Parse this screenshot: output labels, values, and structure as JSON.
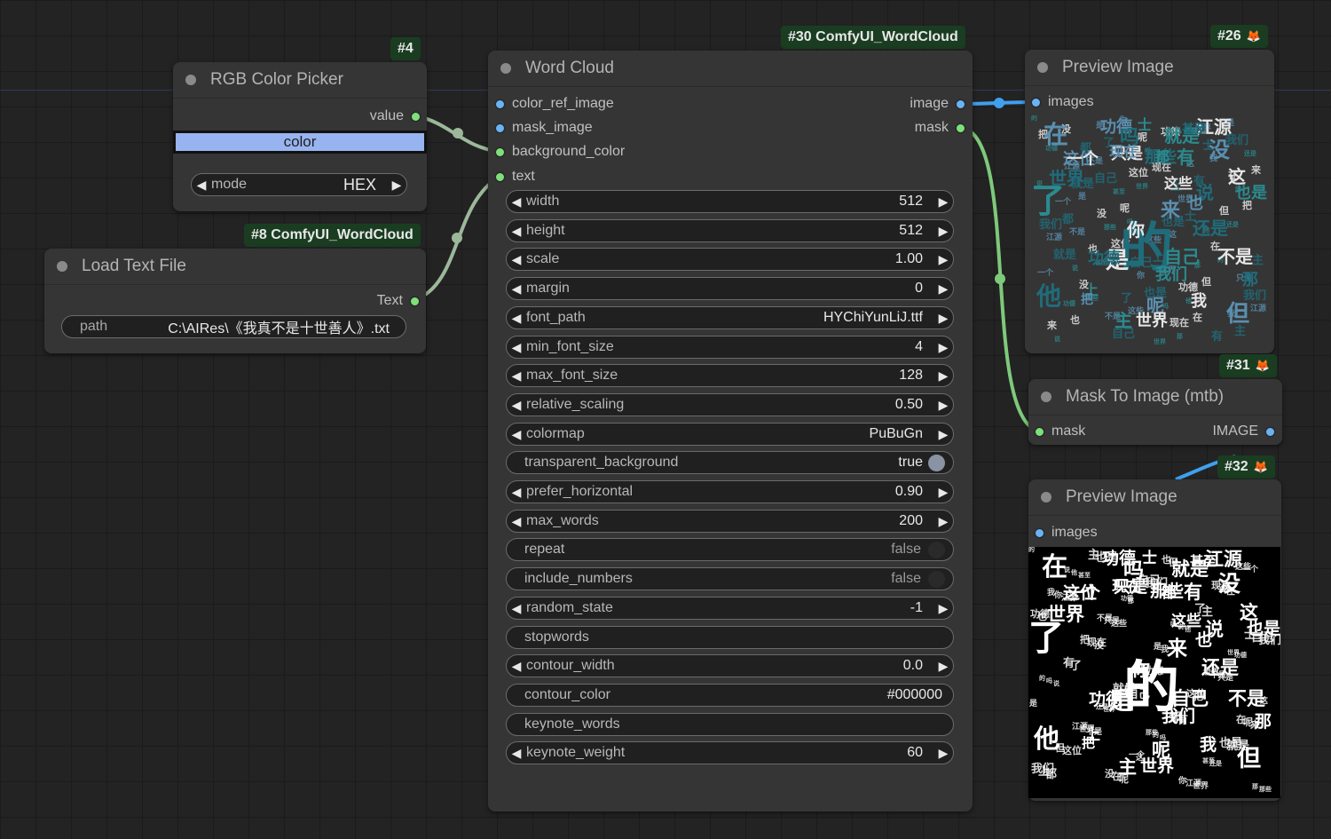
{
  "nodes": {
    "rgb_picker": {
      "badge": "#4",
      "title": "RGB Color Picker",
      "output_label": "value",
      "color_label": "color",
      "color_value": "#98b4f0",
      "mode_label": "mode",
      "mode_value": "HEX"
    },
    "load_text": {
      "badge": "#8 ComfyUI_WordCloud",
      "title": "Load Text File",
      "output_label": "Text",
      "path_label": "path",
      "path_value": "C:\\AIRes\\《我真不是十世善人》.txt"
    },
    "word_cloud": {
      "badge": "#30 ComfyUI_WordCloud",
      "title": "Word Cloud",
      "inputs": [
        "color_ref_image",
        "mask_image",
        "background_color",
        "text"
      ],
      "outputs": [
        "image",
        "mask"
      ],
      "widgets": [
        {
          "label": "width",
          "value": "512",
          "kind": "number"
        },
        {
          "label": "height",
          "value": "512",
          "kind": "number"
        },
        {
          "label": "scale",
          "value": "1.00",
          "kind": "number"
        },
        {
          "label": "margin",
          "value": "0",
          "kind": "number"
        },
        {
          "label": "font_path",
          "value": "HYChiYunLiJ.ttf",
          "kind": "number"
        },
        {
          "label": "min_font_size",
          "value": "4",
          "kind": "number"
        },
        {
          "label": "max_font_size",
          "value": "128",
          "kind": "number"
        },
        {
          "label": "relative_scaling",
          "value": "0.50",
          "kind": "number"
        },
        {
          "label": "colormap",
          "value": "PuBuGn",
          "kind": "number"
        },
        {
          "label": "transparent_background",
          "value": "true",
          "kind": "toggle_on"
        },
        {
          "label": "prefer_horizontal",
          "value": "0.90",
          "kind": "number"
        },
        {
          "label": "max_words",
          "value": "200",
          "kind": "number"
        },
        {
          "label": "repeat",
          "value": "false",
          "kind": "toggle_off"
        },
        {
          "label": "include_numbers",
          "value": "false",
          "kind": "toggle_off"
        },
        {
          "label": "random_state",
          "value": "-1",
          "kind": "number"
        },
        {
          "label": "stopwords",
          "value": "",
          "kind": "text"
        },
        {
          "label": "contour_width",
          "value": "0.0",
          "kind": "number"
        },
        {
          "label": "contour_color",
          "value": "#000000",
          "kind": "text"
        },
        {
          "label": "keynote_words",
          "value": "",
          "kind": "text"
        },
        {
          "label": "keynote_weight",
          "value": "60",
          "kind": "number"
        }
      ]
    },
    "preview_1": {
      "badge": "#26",
      "title": "Preview Image",
      "input_label": "images"
    },
    "mask_to_image": {
      "badge": "#31",
      "title": "Mask To Image (mtb)",
      "input_label": "mask",
      "output_label": "IMAGE"
    },
    "preview_2": {
      "badge": "#32",
      "title": "Preview Image",
      "input_label": "images"
    }
  },
  "colors": {
    "link_green": "#7ec97b",
    "link_blue": "#3fa0ef",
    "badge_bg": "#1a3d21",
    "cloud_teal": [
      "#1f6c7a",
      "#2b8a8f",
      "#5a8fb0",
      "#e6e6e6"
    ],
    "cloud_white": "#ffffff"
  },
  "icons": {
    "badge_icon": "fox-icon"
  },
  "wordcloud_words": [
    "的",
    "了",
    "在",
    "是",
    "他",
    "就是",
    "功德",
    "江源",
    "世界",
    "我们",
    "这位",
    "只是",
    "那些",
    "有",
    "没",
    "这",
    "说",
    "也是",
    "来",
    "你",
    "还是",
    "自己",
    "但",
    "不是",
    "那",
    "都",
    "现在",
    "一个",
    "吗",
    "主",
    "呢",
    "我",
    "甚至",
    "士",
    "也",
    "世界",
    "功德",
    "上",
    "把",
    "这些"
  ]
}
